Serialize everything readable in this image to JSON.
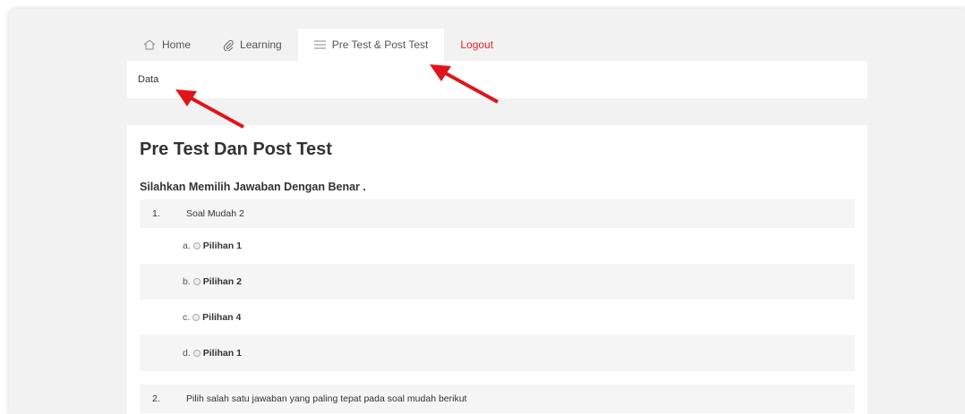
{
  "nav": {
    "tabs": [
      {
        "label": "Home",
        "icon": "home-icon"
      },
      {
        "label": "Learning",
        "icon": "paperclip-icon"
      },
      {
        "label": "Pre Test & Post Test",
        "icon": "menu-lines-icon",
        "active": true
      },
      {
        "label": "Logout",
        "color": "#e0242a"
      }
    ]
  },
  "breadcrumb": "Data",
  "page": {
    "title": "Pre Test Dan Post Test",
    "subtitle": "Silahkan Memilih Jawaban Dengan Benar ."
  },
  "questions": [
    {
      "number": "1.",
      "text": "Soal Mudah 2",
      "options": [
        {
          "letter": "a.",
          "label": "Pilihan 1"
        },
        {
          "letter": "b.",
          "label": "Pilihan 2"
        },
        {
          "letter": "c.",
          "label": "Pilihan 4"
        },
        {
          "letter": "d.",
          "label": "Pilihan 1"
        }
      ]
    },
    {
      "number": "2.",
      "text": "Pilih salah satu jawaban yang paling tepat pada soal mudah berikut"
    }
  ],
  "annotations": {
    "arrow_color": "#e0141a"
  }
}
